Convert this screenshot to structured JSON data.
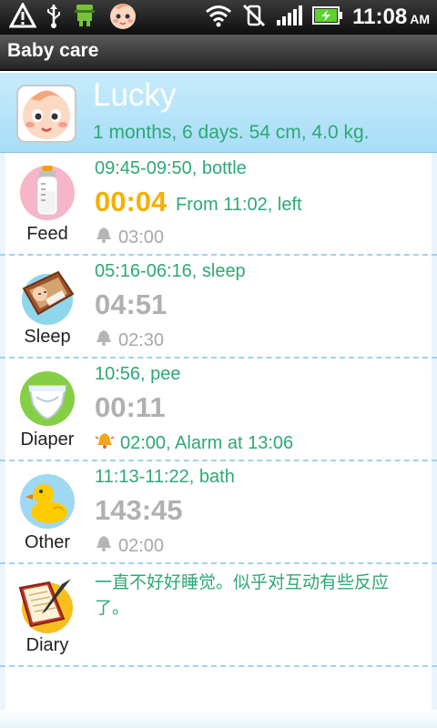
{
  "status_bar": {
    "time": "11:08",
    "ampm": "AM",
    "icons": [
      "warning-icon",
      "usb-icon",
      "android-icon",
      "app-baby-icon",
      "wifi-icon",
      "vibrate-icon",
      "signal-icon",
      "battery-charging-icon"
    ]
  },
  "app": {
    "title": "Baby care"
  },
  "profile": {
    "name": "Lucky",
    "summary": "1 months, 6 days. 54 cm, 4.0 kg."
  },
  "entries": [
    {
      "category": "Feed",
      "icon": "bottle-icon",
      "summary": "09:45-09:50, bottle",
      "elapsed": "00:04",
      "active": true,
      "detail": "From 11:02, left",
      "alarm": "03:00",
      "alarm_on": false
    },
    {
      "category": "Sleep",
      "icon": "crib-icon",
      "summary": "05:16-06:16, sleep",
      "elapsed": "04:51",
      "active": false,
      "detail": "",
      "alarm": "02:30",
      "alarm_on": false
    },
    {
      "category": "Diaper",
      "icon": "diaper-icon",
      "summary": "10:56, pee",
      "elapsed": "00:11",
      "active": false,
      "detail": "",
      "alarm": "02:00, Alarm at 13:06",
      "alarm_on": true
    },
    {
      "category": "Other",
      "icon": "duck-icon",
      "summary": "11:13-11:22, bath",
      "elapsed": "143:45",
      "active": false,
      "detail": "",
      "alarm": "02:00",
      "alarm_on": false
    }
  ],
  "diary": {
    "category": "Diary",
    "icon": "notebook-icon",
    "text": "一直不好好睡觉。似乎对互动有些反应了。"
  },
  "colors": {
    "accent_green": "#2ea875",
    "active_timer": "#f4b000",
    "inactive_timer": "#b0b0b0",
    "header_blue": "#b5e3f9"
  }
}
